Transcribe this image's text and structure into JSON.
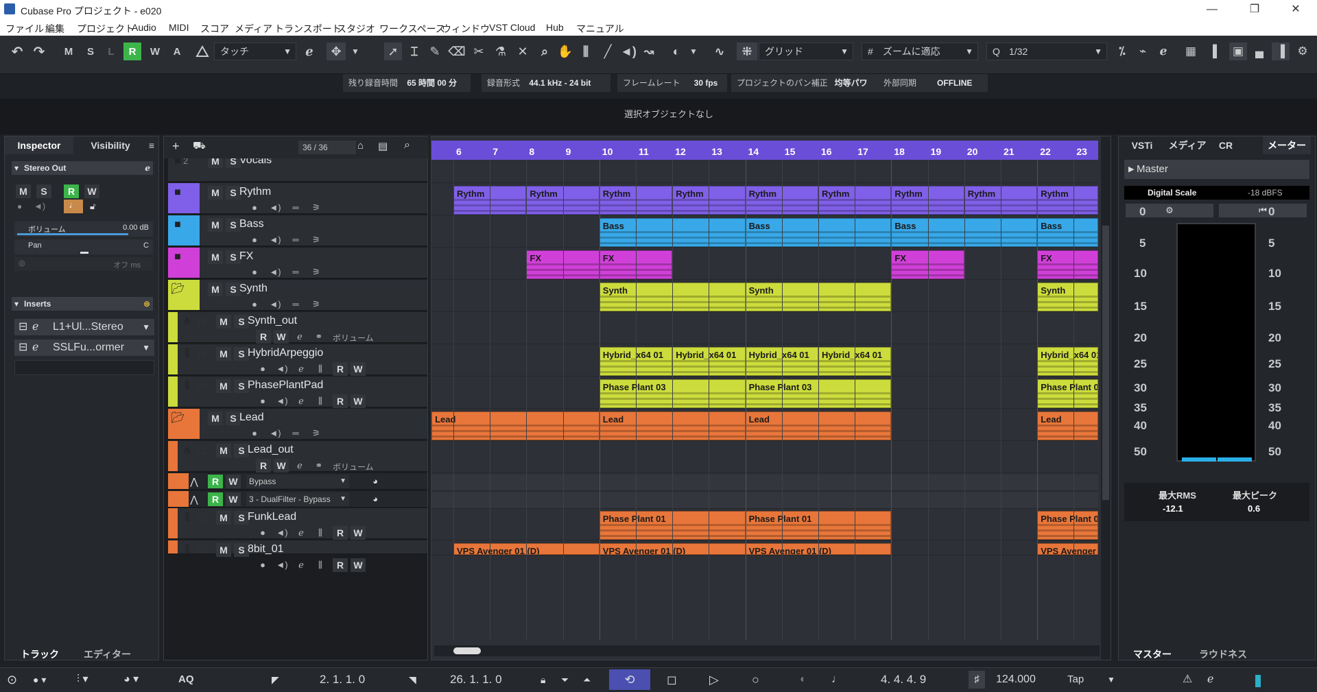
{
  "window": {
    "title": "Cubase Pro プロジェクト - e020",
    "min": "—",
    "restore": "❐",
    "close": "✕"
  },
  "menu": [
    "ファイル",
    "編集",
    "プロジェクト",
    "Audio",
    "MIDI",
    "スコア",
    "メディア",
    "トランスポート",
    "スタジオ",
    "ワークスペース",
    "ウィンドウ",
    "VST Cloud",
    "Hub",
    "マニュアル"
  ],
  "toolbar": {
    "undo": "↶",
    "redo": "↷",
    "modes": [
      "M",
      "S",
      "L",
      "R",
      "W",
      "A"
    ],
    "automation_mode": "タッチ",
    "snap_label": "グリッド",
    "grid_type": "ズームに適応",
    "quantize": "1/32"
  },
  "info": {
    "rec_time_label": "残り録音時間",
    "rec_time_value": "65 時間 00 分",
    "rec_format_label": "録音形式",
    "rec_format_value": "44.1 kHz - 24 bit",
    "frame_rate_label": "フレームレート",
    "frame_rate_value": "30 fps",
    "pan_label": "プロジェクトのパン補正",
    "pan_value": "均等パワー",
    "sync_label": "外部同期",
    "sync_value": "OFFLINE"
  },
  "status_text": "選択オブジェクトなし",
  "inspector": {
    "tab_inspector": "Inspector",
    "tab_visibility": "Visibility",
    "section_title": "Stereo Out",
    "buttons": [
      "M",
      "S",
      "R",
      "W"
    ],
    "volume_label": "ボリューム",
    "volume_value": "0.00 dB",
    "pan_label": "Pan",
    "pan_value": "C",
    "delay_value": "オフ ms",
    "inserts_title": "Inserts",
    "inserts": [
      "L1+Ul...Stereo",
      "SSLFu...ormer"
    ]
  },
  "tracklist": {
    "count": "36 / 36",
    "tracks": [
      {
        "name": "Vocals",
        "num": "2"
      },
      {
        "name": "Rythm"
      },
      {
        "name": "Bass"
      },
      {
        "name": "FX"
      },
      {
        "name": "Synth"
      },
      {
        "name": "Synth_out",
        "num": "18",
        "vol": "ボリューム"
      },
      {
        "name": "HybridArpeggio",
        "num": "19"
      },
      {
        "name": "PhasePlantPad",
        "num": "20"
      },
      {
        "name": "Lead"
      },
      {
        "name": "Lead_out",
        "num": "21",
        "vol": "ボリューム"
      },
      {
        "name": "Bypass"
      },
      {
        "name": "3 - DualFilter - Bypass"
      },
      {
        "name": "FunkLead",
        "num": "22"
      },
      {
        "name": "8bit_01",
        "num": "23"
      }
    ],
    "btn_labels": {
      "m": "M",
      "s": "S",
      "r": "R",
      "w": "W"
    }
  },
  "ruler": [
    "6",
    "7",
    "8",
    "9",
    "10",
    "11",
    "12",
    "13",
    "14",
    "15",
    "16",
    "17",
    "18",
    "19",
    "20",
    "21",
    "22",
    "23"
  ],
  "parts": {
    "rythm": "Rythm",
    "bass": "Bass",
    "fx": "FX",
    "synth": "Synth",
    "hybrid": "Hybrid_x64 01",
    "phase3": "Phase Plant 03",
    "lead": "Lead",
    "phase1": "Phase Plant 01",
    "vps": "VPS Avenger 01 (D)"
  },
  "colors": {
    "rythm": "#8060e8",
    "bass": "#38a8e8",
    "fx": "#d040d8",
    "synth": "#ccdc3c",
    "lead": "#e8763a"
  },
  "rightzone": {
    "tabs": [
      "VSTi",
      "メディア",
      "CR",
      "メーター"
    ],
    "master": "Master",
    "digital_scale": "Digital Scale",
    "dbfs": "-18 dBFS",
    "scale": [
      "0",
      "5",
      "10",
      "15",
      "20",
      "25",
      "30",
      "35",
      "40",
      "50"
    ],
    "rms_label": "最大RMS",
    "rms_value": "-12.1",
    "peak_label": "最大ピーク",
    "peak_value": "0.6",
    "bottom_tabs": [
      "マスター",
      "ラウドネス"
    ]
  },
  "bottom_tabs": [
    "トラック",
    "エディター"
  ],
  "transport": {
    "aq": "AQ",
    "left_locator": "2. 1. 1.   0",
    "right_locator": "26. 1. 1.   0",
    "position": "4. 4. 4.   9",
    "tempo": "124.000",
    "tap": "Tap"
  }
}
